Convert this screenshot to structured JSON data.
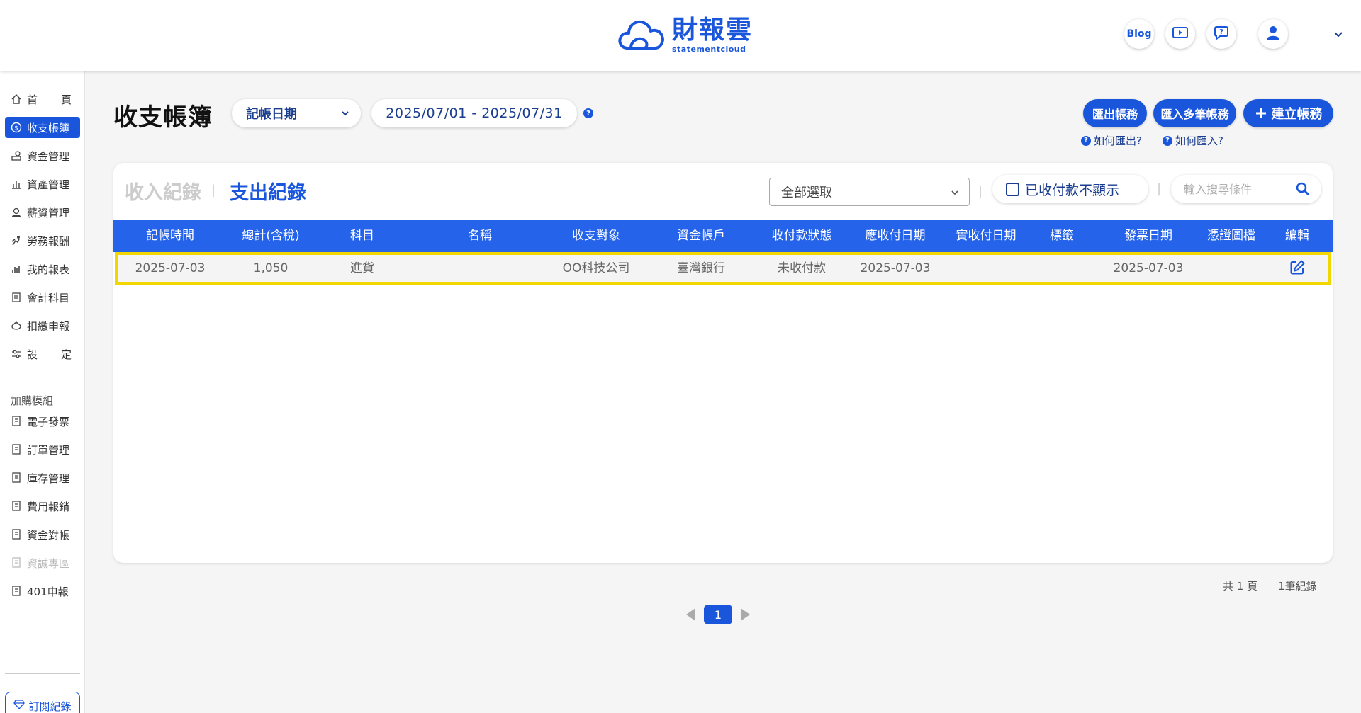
{
  "header": {
    "logo_main": "財報雲",
    "logo_sub": "statementcloud",
    "blog_label": "Blog"
  },
  "sidebar": {
    "items": [
      {
        "label_a": "首",
        "label_b": "頁",
        "icon": "home-icon"
      },
      {
        "label": "收支帳簿",
        "icon": "dollar-circle-icon",
        "active": true
      },
      {
        "label": "資金管理",
        "icon": "hand-coin-icon"
      },
      {
        "label": "資產管理",
        "icon": "building-chart-icon"
      },
      {
        "label": "薪資管理",
        "icon": "payroll-icon"
      },
      {
        "label": "勞務報酬",
        "icon": "worker-icon"
      },
      {
        "label": "我的報表",
        "icon": "bar-chart-icon"
      },
      {
        "label": "會計科目",
        "icon": "ledger-icon"
      },
      {
        "label": "扣繳申報",
        "icon": "tax-icon"
      },
      {
        "label_a": "設",
        "label_b": "定",
        "icon": "sliders-icon"
      }
    ],
    "addon_heading": "加購模組",
    "addons": [
      {
        "label": "電子發票",
        "disabled": false
      },
      {
        "label": "訂單管理",
        "disabled": false
      },
      {
        "label": "庫存管理",
        "disabled": false
      },
      {
        "label": "費用報銷",
        "disabled": false
      },
      {
        "label": "資金對帳",
        "disabled": false
      },
      {
        "label": "資誠專區",
        "disabled": true
      },
      {
        "label": "401申報",
        "disabled": false
      }
    ],
    "subscription_label": "訂閱紀錄"
  },
  "toolbar": {
    "title": "收支帳簿",
    "date_type": "記帳日期",
    "date_range": "2025/07/01 - 2025/07/31",
    "help_mark": "?",
    "export_label": "匯出帳務",
    "import_label": "匯入多筆帳務",
    "create_label": "建立帳務",
    "how_export": "如何匯出?",
    "how_import": "如何匯入?"
  },
  "card": {
    "tab_income": "收入紀錄",
    "tab_expense": "支出紀錄",
    "divider": "|",
    "filter_value": "全部選取",
    "hide_paid_label": "已收付款不顯示",
    "search_placeholder": "輸入搜尋條件"
  },
  "table": {
    "columns": [
      "記帳時間",
      "總計(含稅)",
      "科目",
      "名稱",
      "收支對象",
      "資金帳戶",
      "收付款狀態",
      "應收付日期",
      "實收付日期",
      "標籤",
      "發票日期",
      "憑證圖檔",
      "編輯"
    ],
    "rows": [
      {
        "date": "2025-07-03",
        "total": "1,050",
        "account": "進貨",
        "name": "",
        "party": "OO科技公司",
        "fund_account": "臺灣銀行",
        "status": "未收付款",
        "due_date": "2025-07-03",
        "paid_date": "",
        "tag": "",
        "invoice_date": "2025-07-03",
        "attachment": ""
      }
    ]
  },
  "pagination": {
    "pages_text": "共 1 頁",
    "records_text": "1筆紀錄",
    "current_page": "1"
  },
  "colors": {
    "primary": "#1a56db",
    "table_header": "#2563eb",
    "highlight": "#f2d600"
  }
}
